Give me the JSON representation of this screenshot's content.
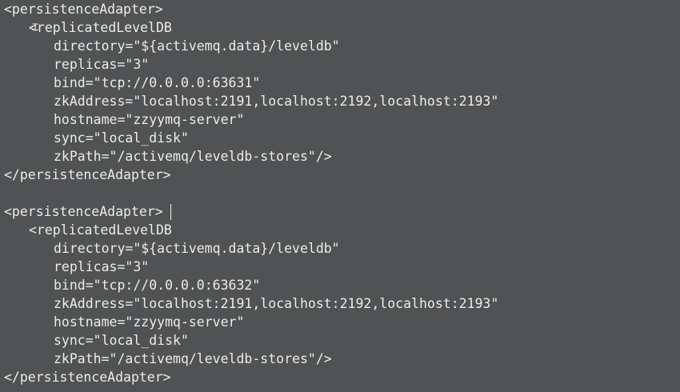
{
  "code": {
    "block1": {
      "open": "<persistenceAdapter>",
      "element_open": "<replicatedLevelDB",
      "directory": "directory=\"${activemq.data}/leveldb\"",
      "replicas": "replicas=\"3\"",
      "bind": "bind=\"tcp://0.0.0.0:63631\"",
      "zkAddress": "zkAddress=\"localhost:2191,localhost:2192,localhost:2193\"",
      "hostname": "hostname=\"zzyymq-server\"",
      "sync": "sync=\"local_disk\"",
      "zkPath": "zkPath=\"/activemq/leveldb-stores\"/>",
      "close": "</persistenceAdapter>"
    },
    "block2": {
      "open": "<persistenceAdapter>",
      "element_open": "<replicatedLevelDB",
      "directory": "directory=\"${activemq.data}/leveldb\"",
      "replicas": "replicas=\"3\"",
      "bind": "bind=\"tcp://0.0.0.0:63632\"",
      "zkAddress": "zkAddress=\"localhost:2191,localhost:2192,localhost:2193\"",
      "hostname": "hostname=\"zzyymq-server\"",
      "sync": "sync=\"local_disk\"",
      "zkPath": "zkPath=\"/activemq/leveldb-stores\"/>",
      "close": "</persistenceAdapter>"
    }
  },
  "colors": {
    "background": "#505253",
    "text": "#ececec"
  }
}
